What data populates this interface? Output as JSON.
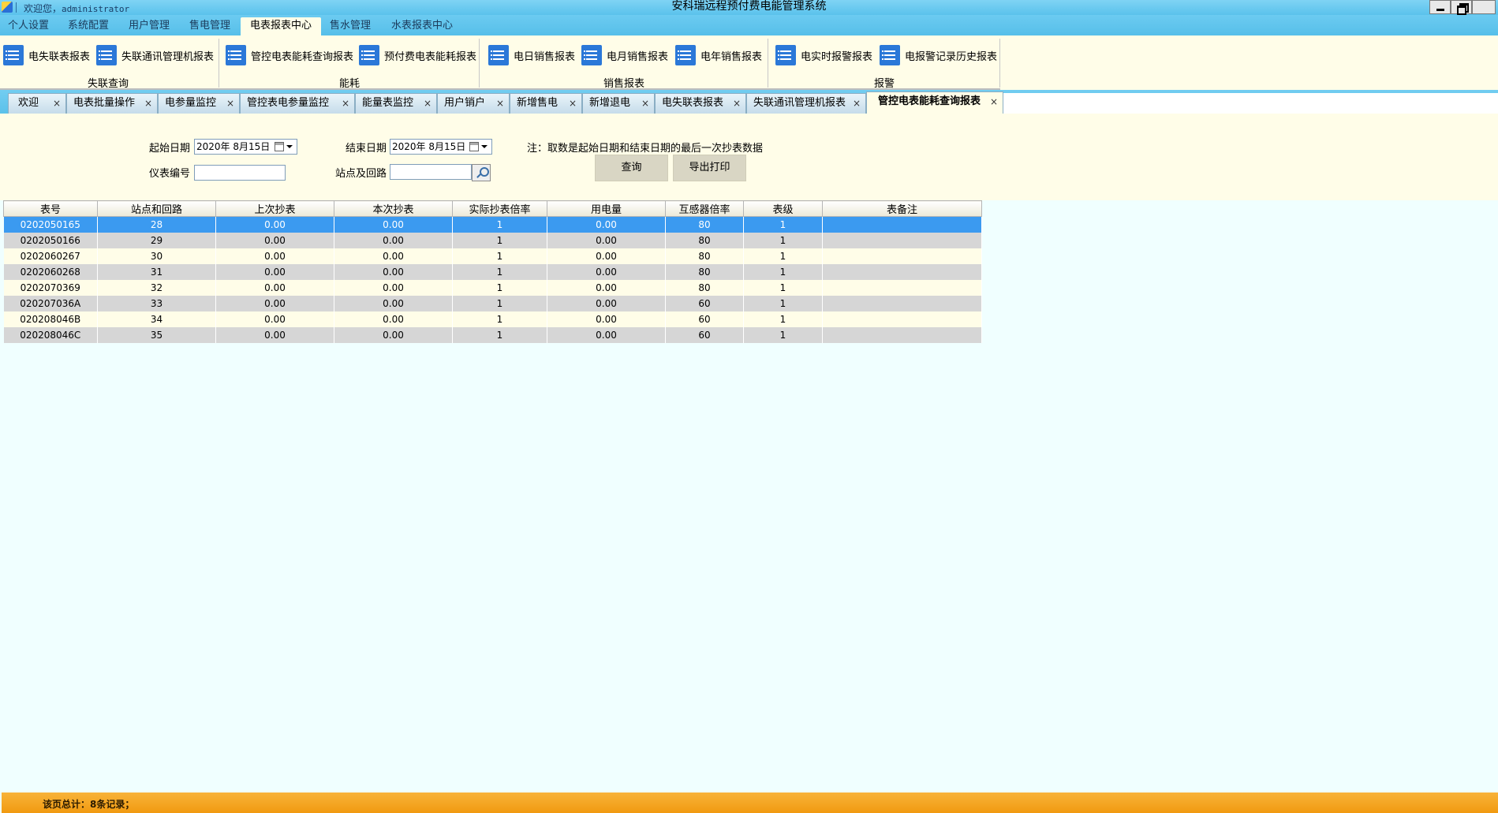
{
  "titlebar": {
    "welcome_prefix": "欢迎您，",
    "user": "administrator",
    "title": "安科瑞远程预付费电能管理系统"
  },
  "menu": [
    "个人设置",
    "系统配置",
    "用户管理",
    "售电管理",
    "电表报表中心",
    "售水管理",
    "水表报表中心"
  ],
  "menu_active": "电表报表中心",
  "ribbon": {
    "groups": [
      {
        "label": "失联查询",
        "buttons": [
          "电失联表报表",
          "失联通讯管理机报表"
        ]
      },
      {
        "label": "能耗",
        "buttons": [
          "管控电表能耗查询报表",
          "预付费电表能耗报表"
        ]
      },
      {
        "label": "销售报表",
        "buttons": [
          "电日销售报表",
          "电月销售报表",
          "电年销售报表"
        ]
      },
      {
        "label": "报警",
        "buttons": [
          "电实时报警报表",
          "电报警记录历史报表"
        ]
      }
    ]
  },
  "doc_tabs": [
    "欢迎",
    "电表批量操作",
    "电参量监控",
    "管控表电参量监控",
    "能量表监控",
    "用户销户",
    "新增售电",
    "新增退电",
    "电失联表报表",
    "失联通讯管理机报表",
    "管控电表能耗查询报表"
  ],
  "doc_tab_close": "×",
  "doc_tab_active": "管控电表能耗查询报表",
  "filter": {
    "start_label": "起始日期",
    "start_value": "2020年  8月15日",
    "end_label": "结束日期",
    "end_value": "2020年  8月15日",
    "meter_label": "仪表编号",
    "meter_value": "",
    "site_label": "站点及回路",
    "site_value": "",
    "note": "注：取数是起始日期和结束日期的最后一次抄表数据",
    "query_button": "查询",
    "export_button": "导出打印"
  },
  "table": {
    "columns": [
      "表号",
      "站点和回路",
      "上次抄表",
      "本次抄表",
      "实际抄表倍率",
      "用电量",
      "互感器倍率",
      "表级",
      "表备注"
    ],
    "rows": [
      [
        "0202050165",
        "28",
        "0.00",
        "0.00",
        "1",
        "0.00",
        "80",
        "1",
        ""
      ],
      [
        "0202050166",
        "29",
        "0.00",
        "0.00",
        "1",
        "0.00",
        "80",
        "1",
        ""
      ],
      [
        "0202060267",
        "30",
        "0.00",
        "0.00",
        "1",
        "0.00",
        "80",
        "1",
        ""
      ],
      [
        "0202060268",
        "31",
        "0.00",
        "0.00",
        "1",
        "0.00",
        "80",
        "1",
        ""
      ],
      [
        "0202070369",
        "32",
        "0.00",
        "0.00",
        "1",
        "0.00",
        "80",
        "1",
        ""
      ],
      [
        "020207036A",
        "33",
        "0.00",
        "0.00",
        "1",
        "0.00",
        "60",
        "1",
        ""
      ],
      [
        "020208046B",
        "34",
        "0.00",
        "0.00",
        "1",
        "0.00",
        "60",
        "1",
        ""
      ],
      [
        "020208046C",
        "35",
        "0.00",
        "0.00",
        "1",
        "0.00",
        "60",
        "1",
        ""
      ]
    ],
    "selected_row": 0
  },
  "status": {
    "text": "该页总计：8条记录；"
  },
  "colors": {
    "title_bar": "#5ac2ec",
    "ribbon_bg": "#fffde8",
    "selected_row": "#3b9af0",
    "status_bar": "#f19a10"
  }
}
